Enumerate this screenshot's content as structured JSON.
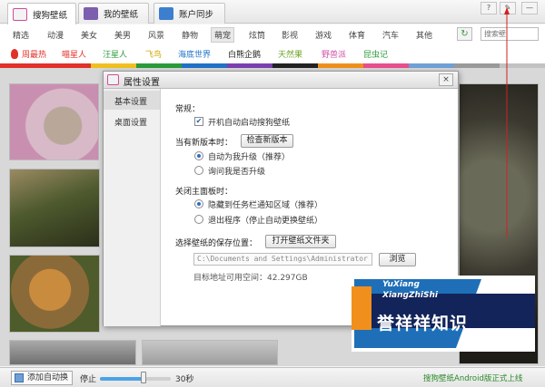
{
  "tabs": [
    {
      "label": "搜狗壁纸",
      "active": true
    },
    {
      "label": "我的壁纸",
      "active": false
    },
    {
      "label": "账户同步",
      "active": false
    }
  ],
  "window_buttons": {
    "help": "?",
    "settings": "✎",
    "minimize": "—"
  },
  "categories": [
    "精选",
    "动漫",
    "美女",
    "美男",
    "风景",
    "静物",
    "萌宠",
    "炫筒",
    "影视",
    "游戏",
    "体育",
    "汽车",
    "其他"
  ],
  "selected_category": "萌宠",
  "search": {
    "placeholder": "搜索壁"
  },
  "collections": [
    {
      "label": "周最热",
      "color": "#e0312b"
    },
    {
      "label": "喵星人",
      "color": "#e0312b"
    },
    {
      "label": "汪星人",
      "color": "#2a9b3a"
    },
    {
      "label": "飞鸟",
      "color": "#c9a800"
    },
    {
      "label": "海底世界",
      "color": "#1f72c7"
    },
    {
      "label": "白熊企鹅",
      "color": "#222222"
    },
    {
      "label": "天然果",
      "color": "#6ea326"
    },
    {
      "label": "野兽派",
      "color": "#d14fa7"
    },
    {
      "label": "昆虫记",
      "color": "#2a9b3a"
    }
  ],
  "colorbar": [
    "#e0312b",
    "#e0312b",
    "#f0c020",
    "#2a9b3a",
    "#1f72c7",
    "#7a3fb0",
    "#222222",
    "#f18f1c",
    "#e74e8c",
    "#6ea0d6",
    "#9a9a9a",
    "#c2c2c2"
  ],
  "dialog": {
    "title": "属性设置",
    "close": "×",
    "nav": [
      "基本设置",
      "桌面设置"
    ],
    "general_label": "常规：",
    "autostart_label": "开机自动启动搜狗壁纸",
    "autostart_checked": true,
    "new_version_label": "当有新版本时：",
    "check_update_btn": "检查新版本",
    "update_options": [
      "自动为我升级（推荐）",
      "询问我是否升级"
    ],
    "update_selected": 0,
    "close_panel_label": "关闭主面板时：",
    "close_options": [
      "隐藏到任务栏通知区域（推荐）",
      "退出程序（停止自动更换壁纸）"
    ],
    "close_selected": 0,
    "save_location_label": "选择壁纸的保存位置：",
    "open_folder_btn": "打开壁纸文件夹",
    "path_value": "C:\\Documents and Settings\\Administrator",
    "browse_btn": "浏览",
    "free_space_text": "目标地址可用空间：42.297GB"
  },
  "bottom": {
    "add_auto": "添加自动换",
    "stop_label": "停止",
    "interval_label": "30秒",
    "interval_fraction": 0.62,
    "promo": "搜狗壁纸Android版正式上线"
  },
  "watermark": {
    "line1": "YuXiang",
    "line2": "XiangZhiShi",
    "line3": "誉祥祥知识"
  }
}
